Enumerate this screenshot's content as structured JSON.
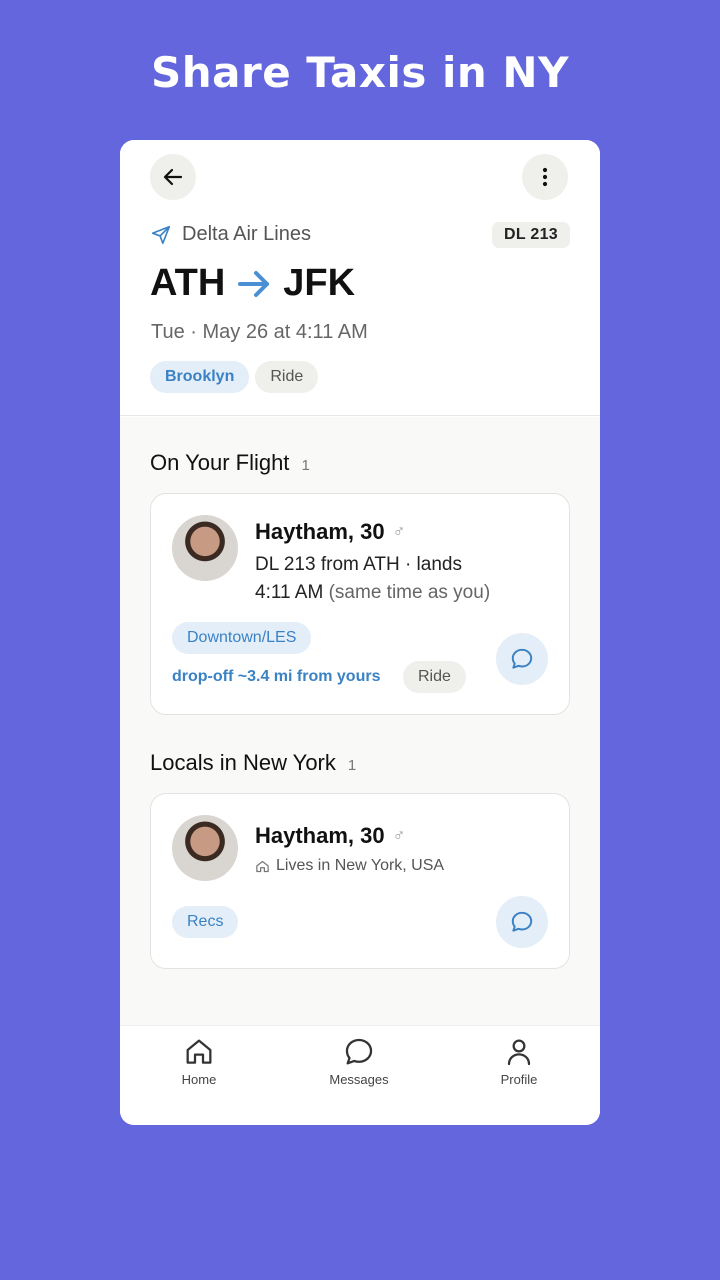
{
  "promo": {
    "title": "Share Taxis in NY"
  },
  "header": {
    "airline": "Delta Air Lines",
    "flight_code": "DL 213",
    "origin": "ATH",
    "destination": "JFK",
    "datetime": "Tue · May 26 at 4:11 AM",
    "chips": [
      "Brooklyn",
      "Ride"
    ]
  },
  "on_flight": {
    "title": "On Your Flight",
    "count": "1",
    "card": {
      "name": "Haytham, 30",
      "gender_symbol": "♂",
      "line1": "DL 213 from ATH · lands",
      "line2_time": "4:11 AM",
      "line2_note": "(same time as you)",
      "chip": "Downtown/LES",
      "dropoff": "drop-off ~3.4 mi from yours",
      "ride_chip": "Ride"
    }
  },
  "locals": {
    "title": "Locals in New York",
    "count": "1",
    "card": {
      "name": "Haytham, 30",
      "gender_symbol": "♂",
      "lives": "Lives in New York, USA",
      "chip": "Recs"
    }
  },
  "tabs": [
    {
      "label": "Home",
      "icon": "home-icon"
    },
    {
      "label": "Messages",
      "icon": "messages-icon"
    },
    {
      "label": "Profile",
      "icon": "profile-icon"
    }
  ],
  "colors": {
    "background": "#6366dd",
    "accent": "#3a82c4",
    "chip_blue_bg": "#e4eef8",
    "chip_gray_bg": "#efefec",
    "route_arrow": "#4a8fd4"
  }
}
